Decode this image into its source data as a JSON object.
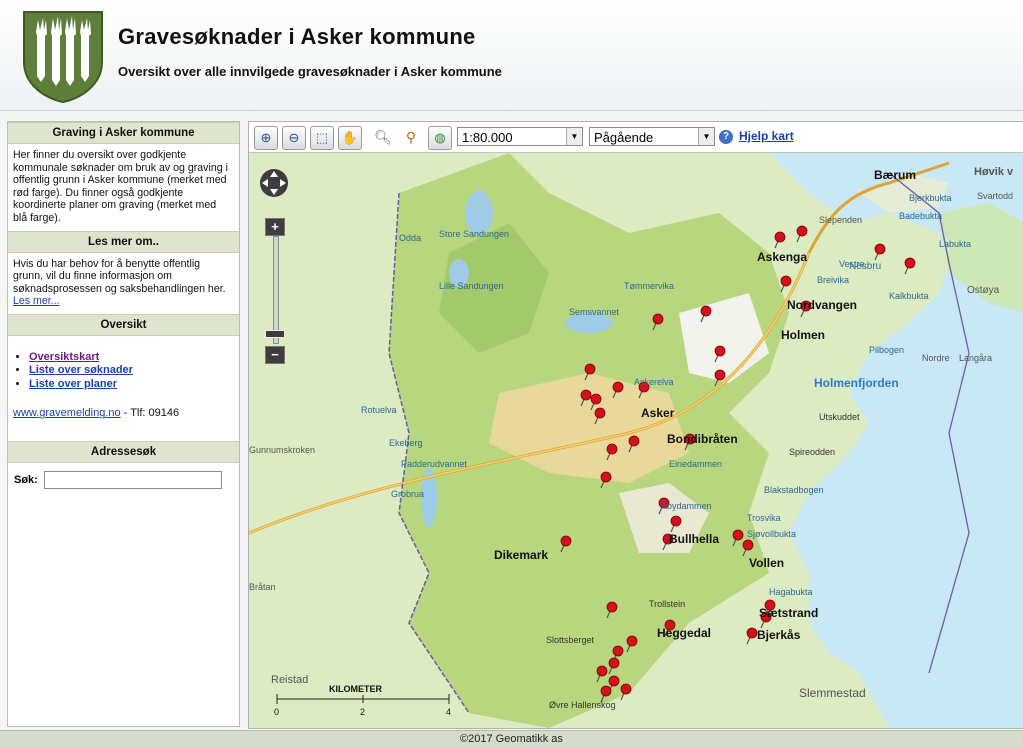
{
  "header": {
    "title": "Gravesøknader i Asker kommune",
    "subtitle": "Oversikt over alle innvilgede gravesøknader i Asker kommune"
  },
  "sidebar": {
    "section1": {
      "heading": "Graving i Asker kommune",
      "text": "Her finner du oversikt over godkjente kommunale søknader om bruk av og graving i offentlig grunn i Asker kommune (merket med rød farge). Du finner også godkjente koordinerte planer om graving (merket med blå farge)."
    },
    "section2": {
      "heading": "Les mer om..",
      "text": "Hvis du har behov for å benytte offentlig grunn, vil du finne informasjon om søknadsprosessen og saksbehandlingen her.",
      "link": "Les mer..."
    },
    "section3": {
      "heading": "Oversikt",
      "links": [
        "Oversiktskart",
        "Liste over søknader",
        "Liste over planer"
      ],
      "website": "www.gravemelding.no",
      "phone": " - Tlf: 09146"
    },
    "section4": {
      "heading": "Adressesøk",
      "search_label": "Søk:",
      "search_value": ""
    }
  },
  "toolbar": {
    "icons": [
      "zoom-in-icon",
      "zoom-out-icon",
      "zoom-box-icon",
      "pan-hand-icon",
      "search-icon",
      "find-icon",
      "globe-icon"
    ],
    "scale_value": "1:80.000",
    "filter_value": "Pågående",
    "help_label": "Hjelp kart"
  },
  "map": {
    "place_labels": [
      "Bærum",
      "Høvik v",
      "Askenga",
      "Nesbru",
      "Nordvangen",
      "Holmen",
      "Holmenfjorden",
      "Asker",
      "Bondibråten",
      "Dikemark",
      "Bullhella",
      "Vollen",
      "Heggedal",
      "Sætstrand",
      "Bjerkås",
      "Reistad",
      "Slemmestad",
      "Ostøya"
    ],
    "water_labels": [
      "Store Sandungen",
      "Lille Sandungen",
      "Semsvannet",
      "Padderudvannet",
      "Tømmervika",
      "Ekeberg",
      "Bjerkbukta",
      "Blakstadbogen",
      "Spireodden",
      "Utskuddet",
      "Pilbogen",
      "Langåra",
      "Kalkbukta",
      "Badebukta",
      "Labukta",
      "Svartodd",
      "Breivika",
      "Vestre",
      "Einedammen",
      "Åbydammen",
      "Sjøvollbukta",
      "Trosvika",
      "Hagabukta",
      "Trollstein",
      "Slottsberget",
      "Øvre Hallenskog",
      "Grobrua",
      "Rotuelva",
      "Askerelva",
      "Nordre",
      "Bråtan",
      "Gunnumskroken",
      "Slependen",
      "Odda"
    ],
    "scale_title": "KILOMETER",
    "scale_ticks": [
      "0",
      "2",
      "4"
    ]
  },
  "footer": {
    "copyright": "©2017 Geomatikk as"
  }
}
